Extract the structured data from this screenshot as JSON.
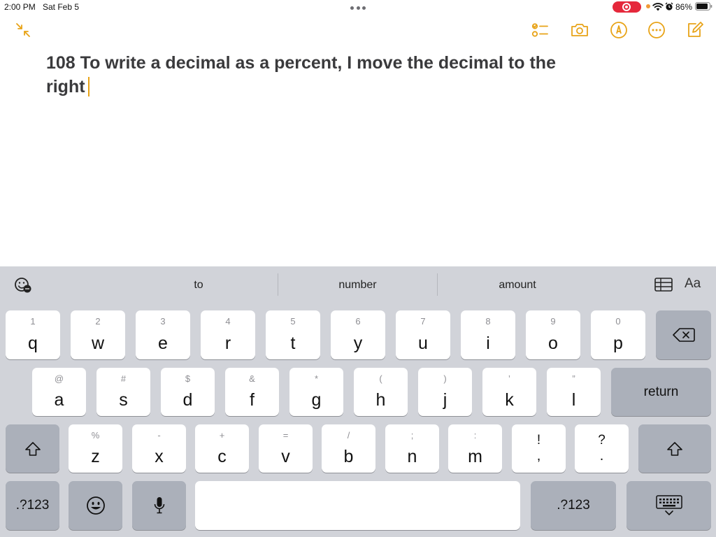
{
  "status_bar": {
    "time": "2:00 PM",
    "date": "Sat Feb 5",
    "battery": "86%"
  },
  "toolbar": {
    "collapse_icon": "collapse-arrows-icon",
    "checklist_icon": "checklist-icon",
    "camera_icon": "camera-icon",
    "markup_icon": "markup-pen-icon",
    "more_icon": "ellipsis-circle-icon",
    "compose_icon": "compose-icon",
    "accent_color": "#e8a317"
  },
  "note": {
    "text": "108 To write a decimal as a percent, I move the decimal to the right"
  },
  "keyboard": {
    "suggestions": [
      "to",
      "number",
      "amount"
    ],
    "format_label": "Aa",
    "row1": [
      {
        "hint": "1",
        "main": "q"
      },
      {
        "hint": "2",
        "main": "w"
      },
      {
        "hint": "3",
        "main": "e"
      },
      {
        "hint": "4",
        "main": "r"
      },
      {
        "hint": "5",
        "main": "t"
      },
      {
        "hint": "6",
        "main": "y"
      },
      {
        "hint": "7",
        "main": "u"
      },
      {
        "hint": "8",
        "main": "i"
      },
      {
        "hint": "9",
        "main": "o"
      },
      {
        "hint": "0",
        "main": "p"
      }
    ],
    "row2": [
      {
        "hint": "@",
        "main": "a"
      },
      {
        "hint": "#",
        "main": "s"
      },
      {
        "hint": "$",
        "main": "d"
      },
      {
        "hint": "&",
        "main": "f"
      },
      {
        "hint": "*",
        "main": "g"
      },
      {
        "hint": "(",
        "main": "h"
      },
      {
        "hint": ")",
        "main": "j"
      },
      {
        "hint": "’",
        "main": "k"
      },
      {
        "hint": "”",
        "main": "l"
      }
    ],
    "row3": [
      {
        "hint": "%",
        "main": "z"
      },
      {
        "hint": "-",
        "main": "x"
      },
      {
        "hint": "+",
        "main": "c"
      },
      {
        "hint": "=",
        "main": "v"
      },
      {
        "hint": "/",
        "main": "b"
      },
      {
        "hint": ";",
        "main": "n"
      },
      {
        "hint": ":",
        "main": "m"
      },
      {
        "hint": "!",
        "main": ","
      },
      {
        "hint": "?",
        "main": "."
      }
    ],
    "return_label": "return",
    "numbers_label": ".?123"
  }
}
